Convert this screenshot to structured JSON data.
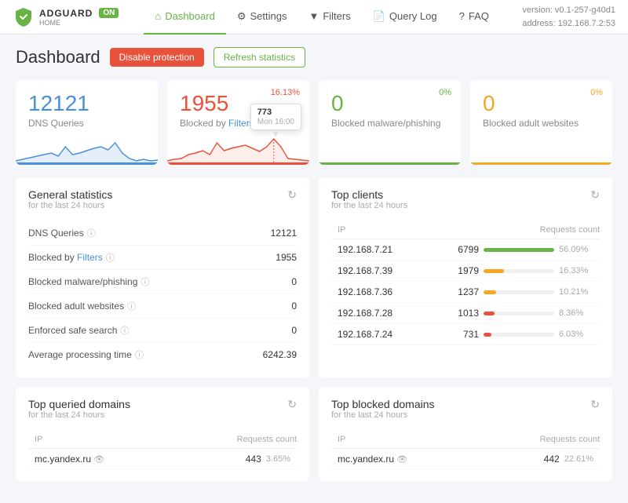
{
  "header": {
    "logo_text": "ADGUARD",
    "logo_home": "HOME",
    "on_badge": "ON",
    "version": "version: v0.1-257-g40d1",
    "address": "address: 192.168.7.2:53",
    "nav": [
      {
        "label": "Dashboard",
        "icon": "⌂",
        "active": true
      },
      {
        "label": "Settings",
        "icon": "⚙",
        "active": false
      },
      {
        "label": "Filters",
        "icon": "⊿",
        "active": false
      },
      {
        "label": "Query Log",
        "icon": "📄",
        "active": false
      },
      {
        "label": "FAQ",
        "icon": "?",
        "active": false
      }
    ]
  },
  "page": {
    "title": "Dashboard",
    "btn_disable": "Disable protection",
    "btn_refresh": "Refresh statistics"
  },
  "stats_cards": [
    {
      "id": "dns-queries",
      "number": "12121",
      "label": "DNS Queries",
      "color": "blue",
      "percent": null,
      "has_chart": true
    },
    {
      "id": "blocked-filters",
      "number": "1955",
      "label": "Blocked by Filters",
      "label_link": "Filters",
      "color": "red",
      "percent": "16.13%",
      "has_chart": true,
      "tooltip": "773\nMon 16:00"
    },
    {
      "id": "blocked-malware",
      "number": "0",
      "label": "Blocked malware/phishing",
      "color": "green",
      "percent": "0%",
      "has_chart": false
    },
    {
      "id": "blocked-adult",
      "number": "0",
      "label": "Blocked adult websites",
      "color": "yellow",
      "percent": "0%",
      "has_chart": false
    }
  ],
  "general_stats": {
    "title": "General statistics",
    "subtitle": "for the last 24 hours",
    "rows": [
      {
        "label": "DNS Queries",
        "has_help": true,
        "value": "12121"
      },
      {
        "label": "Blocked by Filters",
        "has_help": true,
        "value": "1955",
        "is_filter_link": true
      },
      {
        "label": "Blocked malware/phishing",
        "has_help": true,
        "value": "0"
      },
      {
        "label": "Blocked adult websites",
        "has_help": true,
        "value": "0"
      },
      {
        "label": "Enforced safe search",
        "has_help": true,
        "value": "0"
      },
      {
        "label": "Average processing time",
        "has_help": true,
        "value": "6242.39"
      }
    ]
  },
  "top_clients": {
    "title": "Top clients",
    "subtitle": "for the last 24 hours",
    "col_ip": "IP",
    "col_requests": "Requests count",
    "rows": [
      {
        "ip": "192.168.7.21",
        "count": "6799",
        "pct": "56.09%",
        "bar_pct": 100,
        "bar_color": "green"
      },
      {
        "ip": "192.168.7.39",
        "count": "1979",
        "pct": "16.33%",
        "bar_pct": 29,
        "bar_color": "yellow"
      },
      {
        "ip": "192.168.7.36",
        "count": "1237",
        "pct": "10.21%",
        "bar_pct": 18,
        "bar_color": "yellow"
      },
      {
        "ip": "192.168.7.28",
        "count": "1013",
        "pct": "8.36%",
        "bar_pct": 15,
        "bar_color": "red"
      },
      {
        "ip": "192.168.7.24",
        "count": "731",
        "pct": "6.03%",
        "bar_pct": 11,
        "bar_color": "red"
      }
    ]
  },
  "top_queried": {
    "title": "Top queried domains",
    "subtitle": "for the last 24 hours",
    "col_ip": "IP",
    "col_requests": "Requests count",
    "rows": [
      {
        "ip": "mc.yandex.ru",
        "count": "443",
        "pct": "3.65%",
        "has_eye": true
      }
    ]
  },
  "top_blocked": {
    "title": "Top blocked domains",
    "subtitle": "for the last 24 hours",
    "col_ip": "IP",
    "col_requests": "Requests count",
    "rows": [
      {
        "ip": "mc.yandex.ru",
        "count": "442",
        "pct": "22.61%",
        "has_eye": true
      }
    ]
  }
}
